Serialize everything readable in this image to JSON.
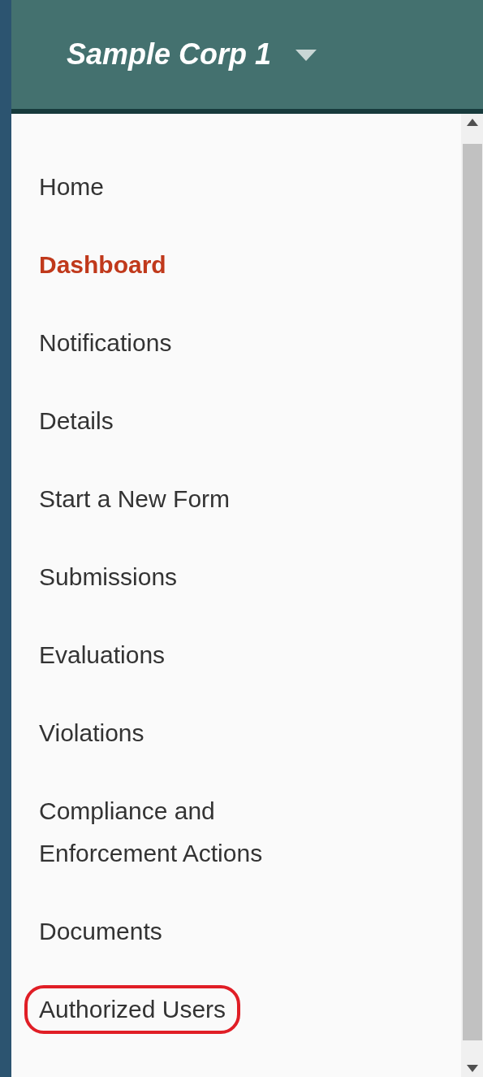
{
  "header": {
    "title": "Sample Corp 1"
  },
  "menu": [
    {
      "label": "Home",
      "selected": false,
      "highlighted": false
    },
    {
      "label": "Dashboard",
      "selected": true,
      "highlighted": false
    },
    {
      "label": "Notifications",
      "selected": false,
      "highlighted": false
    },
    {
      "label": "Details",
      "selected": false,
      "highlighted": false
    },
    {
      "label": "Start a New Form",
      "selected": false,
      "highlighted": false
    },
    {
      "label": "Submissions",
      "selected": false,
      "highlighted": false
    },
    {
      "label": "Evaluations",
      "selected": false,
      "highlighted": false
    },
    {
      "label": "Violations",
      "selected": false,
      "highlighted": false
    },
    {
      "label": "Compliance and Enforcement Actions",
      "selected": false,
      "highlighted": false
    },
    {
      "label": "Documents",
      "selected": false,
      "highlighted": false
    },
    {
      "label": "Authorized Users",
      "selected": false,
      "highlighted": true
    }
  ]
}
